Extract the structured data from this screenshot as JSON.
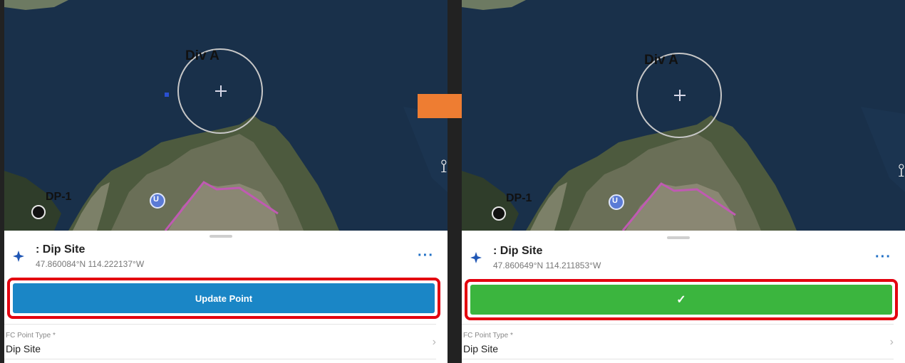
{
  "colors": {
    "water": "#19304a",
    "land": "#4d5a3e",
    "route": "#c05ab3",
    "highlight_frame": "#e3000f",
    "update_button": "#1a86c6",
    "confirm_button": "#3bb53e",
    "arrow": "#ee7d32",
    "more_icon": "#1f6fc5"
  },
  "before": {
    "map": {
      "division_label": "Div A",
      "dip_label": "DP-1",
      "unit_marker_label": "U"
    },
    "feature": {
      "icon": "compass-star-icon",
      "title": ": Dip Site",
      "coords": "47.860084°N  114.222137°W"
    },
    "action_button": {
      "label": "Update Point",
      "state": "update"
    },
    "field": {
      "label": "FC Point Type *",
      "value": "Dip Site"
    }
  },
  "after": {
    "map": {
      "division_label": "Div A",
      "dip_label": "DP-1",
      "unit_marker_label": "U"
    },
    "feature": {
      "icon": "compass-star-icon",
      "title": ": Dip Site",
      "coords": "47.860649°N  114.211853°W"
    },
    "action_button": {
      "label": "✓",
      "state": "confirmed"
    },
    "field": {
      "label": "FC Point Type *",
      "value": "Dip Site"
    }
  },
  "transition": {
    "icon": "right-arrow-icon"
  }
}
